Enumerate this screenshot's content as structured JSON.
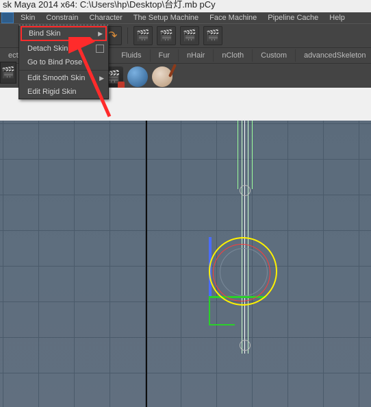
{
  "titlebar": "sk Maya 2014 x64: C:\\Users\\hp\\Desktop\\台灯.mb     pCy",
  "menu": {
    "skin": "Skin",
    "constrain": "Constrain",
    "character": "Character",
    "setup_machine": "The Setup Machine",
    "face_machine": "Face Machine",
    "pipeline_cache": "Pipeline Cache",
    "help": "Help"
  },
  "shelf_tabs": {
    "ects": "ects",
    "fluids": "Fluids",
    "fur": "Fur",
    "nhair": "nHair",
    "ncloth": "nCloth",
    "custom": "Custom",
    "advanced_skeleton": "advancedSkeleton"
  },
  "skin_menu": {
    "bind_skin": "Bind Skin",
    "detach_skin": "Detach Skin",
    "go_to_bind_pose": "Go to Bind Pose",
    "edit_smooth_skin": "Edit Smooth Skin",
    "edit_rigid_skin": "Edit Rigid Skin"
  },
  "colors": {
    "highlight": "#ff2b2b"
  }
}
